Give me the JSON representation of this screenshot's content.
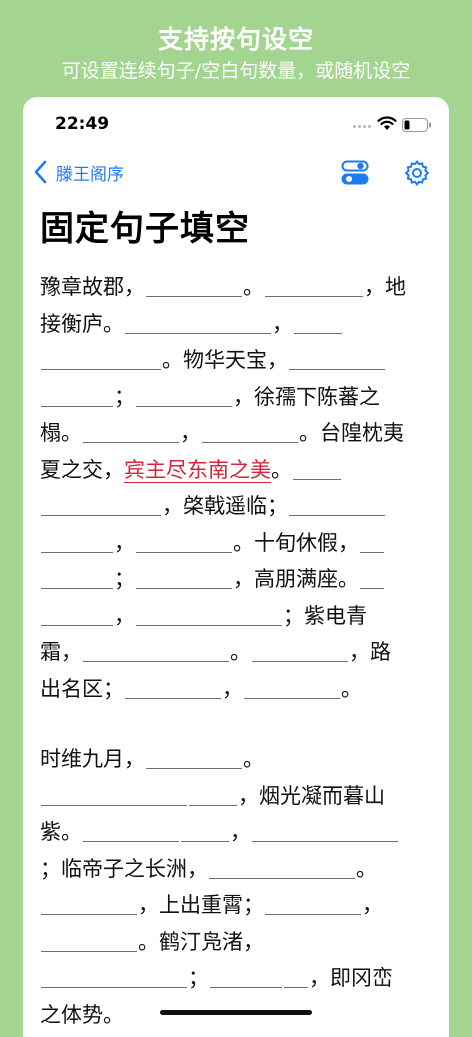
{
  "banner": {
    "title": "支持按句设空",
    "subtitle": "可设置连续句子/空白句数量，或随机设空"
  },
  "status_bar": {
    "time": "22:49"
  },
  "nav": {
    "back_label": "滕王阁序"
  },
  "page": {
    "title": "固定句子填空"
  },
  "paragraph1": [
    "豫章故郡，",
    {
      "w": 96
    },
    "。",
    {
      "w": 98
    },
    "，",
    "地接衡庐。",
    {
      "w": 146
    },
    "，",
    {
      "w": 48
    },
    {
      "w": 120
    },
    "。物华天宝，",
    {
      "w": 96
    },
    {
      "w": 72
    },
    "；",
    {
      "w": 96
    },
    "，徐孺下陈蕃之",
    "榻。",
    {
      "w": 96
    },
    "，",
    {
      "w": 96
    },
    "。台隍枕",
    "夷夏之交，",
    {
      "t": "宾主尽东南之美"
    },
    "。",
    {
      "w": 48
    },
    {
      "w": 120
    },
    "，棨戟遥临；",
    {
      "w": 96
    },
    {
      "w": 72
    },
    "，",
    {
      "w": 96
    },
    "。十旬休假，",
    {
      "w": 24
    },
    {
      "w": 72
    },
    "；",
    {
      "w": 96
    },
    "，高朋满座。",
    {
      "w": 24
    },
    {
      "w": 72
    },
    "，",
    {
      "w": 146
    },
    "；紫电青",
    "霜，",
    {
      "w": 146
    },
    "。",
    {
      "w": 96
    },
    "，路",
    "出名区；",
    {
      "w": 96
    },
    "，",
    {
      "w": 96
    },
    "。"
  ],
  "paragraph2": [
    "时维九月，",
    {
      "w": 96
    },
    "。",
    {
      "w": 146
    },
    {
      "w": 48
    },
    "，烟光凝而暮山紫。",
    {
      "w": 96
    },
    {
      "w": 48
    },
    "，",
    {
      "w": 146
    },
    "；临帝子之长",
    "洲，",
    {
      "w": 146
    },
    "。",
    {
      "w": 96
    },
    "，上",
    "出重霄；",
    {
      "w": 96
    },
    "，",
    {
      "w": 96
    },
    "。鹤",
    "汀凫渚，",
    {
      "w": 146
    },
    "；",
    {
      "w": 72
    },
    {
      "w": 24
    },
    "，即冈峦之体势。"
  ]
}
